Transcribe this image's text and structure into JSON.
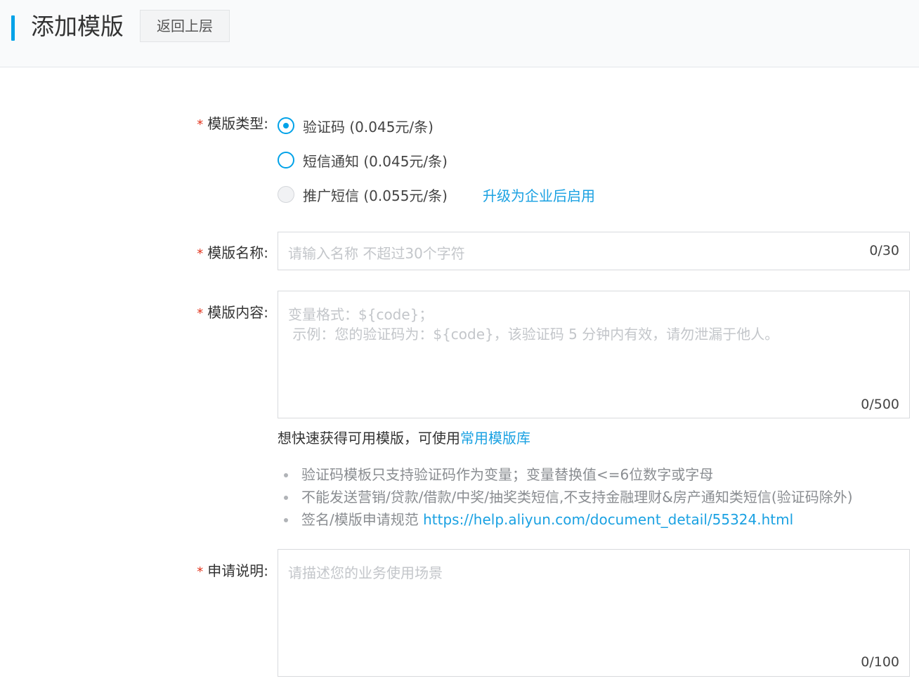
{
  "header": {
    "title": "添加模版",
    "back_label": "返回上层"
  },
  "form": {
    "required_mark": "*",
    "type": {
      "label": "模版类型:",
      "options": [
        {
          "label": "验证码 (0.045元/条)",
          "state": "checked"
        },
        {
          "label": "短信通知 (0.045元/条)",
          "state": "unchecked"
        },
        {
          "label": "推广短信 (0.055元/条)",
          "state": "disabled"
        }
      ],
      "upgrade_link": "升级为企业后启用"
    },
    "name": {
      "label": "模版名称:",
      "placeholder": "请输入名称 不超过30个字符",
      "counter": "0/30"
    },
    "content": {
      "label": "模版内容:",
      "placeholder_line1": "变量格式：${code}；",
      "placeholder_line2": " 示例：您的验证码为：${code}，该验证码 5 分钟内有效，请勿泄漏于他人。",
      "counter": "0/500"
    },
    "hint": {
      "text": "想快速获得可用模版，可使用",
      "link": "常用模版库"
    },
    "notes": [
      {
        "text": "验证码模板只支持验证码作为变量；变量替换值<=6位数字或字母"
      },
      {
        "text": "不能发送营销/贷款/借款/中奖/抽奖类短信,不支持金融理财&房产通知类短信(验证码除外)"
      },
      {
        "text": "签名/模版申请规范 ",
        "link": "https://help.aliyun.com/document_detail/55324.html"
      }
    ],
    "description": {
      "label": "申请说明:",
      "placeholder": "请描述您的业务使用场景",
      "counter": "0/100"
    }
  },
  "colors": {
    "accent": "#00a2e8",
    "link": "#1aa1e2",
    "required": "#e2341d"
  }
}
